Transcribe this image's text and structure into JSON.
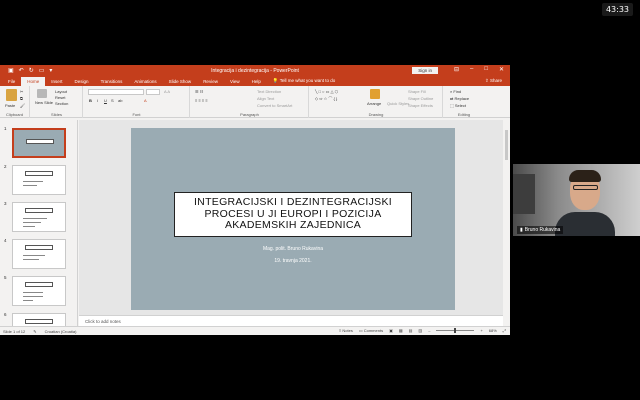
{
  "timer": "43:33",
  "window": {
    "title": "Integracija i dezintegracija - PowerPoint",
    "signin": "Sign in",
    "colors": {
      "accent": "#c43e1c",
      "slide_bg": "#9aabb3"
    }
  },
  "tabs": [
    "File",
    "Home",
    "Insert",
    "Design",
    "Transitions",
    "Animations",
    "Slide Show",
    "Review",
    "View",
    "Help"
  ],
  "tellme": "Tell me what you want to do",
  "share": "Share",
  "ribbon": {
    "clipboard": {
      "label": "Clipboard",
      "paste": "Paste"
    },
    "slides": {
      "label": "Slides",
      "new_slide": "New Slide",
      "layout": "Layout",
      "reset": "Reset",
      "section": "Section"
    },
    "font": {
      "label": "Font"
    },
    "paragraph": {
      "label": "Paragraph",
      "text_direction": "Text Direction",
      "align_text": "Align Text",
      "convert_smartart": "Convert to SmartArt"
    },
    "drawing": {
      "label": "Drawing",
      "arrange": "Arrange",
      "quick_styles": "Quick Styles",
      "shape_fill": "Shape Fill",
      "shape_outline": "Shape Outline",
      "shape_effects": "Shape Effects"
    },
    "editing": {
      "label": "Editing",
      "find": "Find",
      "replace": "Replace",
      "select": "Select"
    }
  },
  "thumbnails": [
    "1",
    "2",
    "3",
    "4",
    "5",
    "6"
  ],
  "slide": {
    "title_lines": [
      "INTEGRACIJSKI I DEZINTEGRACIJSKI",
      "PROCESI U JI EUROPI I POZICIJA",
      "AKADEMSKIH ZAJEDNICA"
    ],
    "author": "Mag. polit. Bruno Rukavina",
    "date": "19. travnja 2021."
  },
  "notes_placeholder": "Click to add notes",
  "status": {
    "slide_count": "Slide 1 of 12",
    "language": "Croatian (Croatia)",
    "notes": "Notes",
    "comments": "Comments",
    "zoom": "68%"
  },
  "video": {
    "participant_name": "Bruno Rukavina"
  }
}
